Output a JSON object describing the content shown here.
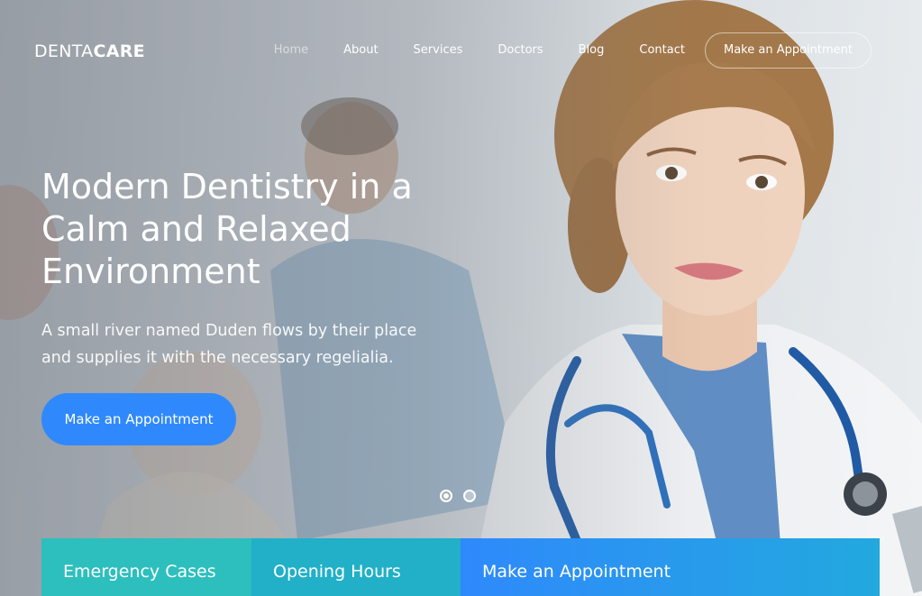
{
  "brand": {
    "logo_light": "DENTA",
    "logo_bold": "CARE"
  },
  "nav": {
    "items": [
      {
        "label": "Home",
        "active": true
      },
      {
        "label": "About"
      },
      {
        "label": "Services"
      },
      {
        "label": "Doctors"
      },
      {
        "label": "Blog"
      },
      {
        "label": "Contact"
      }
    ],
    "cta_label": "Make an Appointment"
  },
  "hero": {
    "headline": "Modern Dentistry in a Calm and Relaxed Environment",
    "subtext": "A small river named Duden flows by their place and supplies it with the necessary regelialia.",
    "cta_label": "Make an Appointment",
    "image": "doctor-with-stethoscope-photo"
  },
  "carousel": {
    "slide_count": 2,
    "active_index": 0
  },
  "info_cards": [
    {
      "title": "Emergency Cases"
    },
    {
      "title": "Opening Hours"
    },
    {
      "title": "Make an Appointment"
    }
  ],
  "colors": {
    "accent_blue": "#2f89fc",
    "card_teal": "#2cbfbd",
    "card_cyan": "#21b0c8",
    "card_gradient_end": "#22a9de"
  }
}
